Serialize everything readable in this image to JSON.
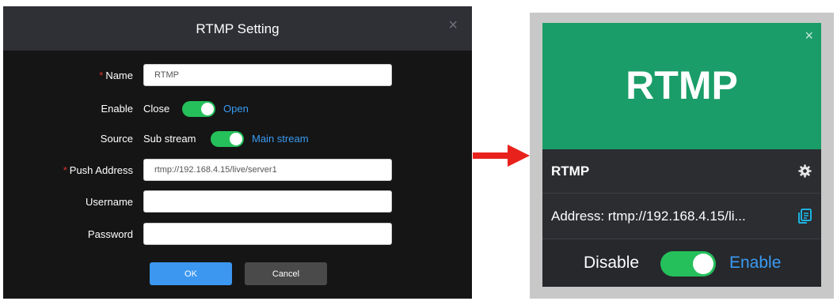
{
  "dialog": {
    "title": "RTMP Setting",
    "close_glyph": "×",
    "required_mark": "*",
    "name": {
      "label": "Name",
      "value": "RTMP"
    },
    "enable": {
      "label": "Enable",
      "off_text": "Close",
      "on_text": "Open",
      "state": "on"
    },
    "source": {
      "label": "Source",
      "off_text": "Sub stream",
      "on_text": "Main stream",
      "state": "on"
    },
    "push_address": {
      "label": "Push Address",
      "value": "rtmp://192.168.4.15/live/server1"
    },
    "username": {
      "label": "Username",
      "value": ""
    },
    "password": {
      "label": "Password",
      "value": ""
    },
    "ok_label": "OK",
    "cancel_label": "Cancel"
  },
  "card": {
    "big_title": "RTMP",
    "close_glyph": "×",
    "name": "RTMP",
    "address": "Address: rtmp://192.168.4.15/li...",
    "disable_text": "Disable",
    "enable_text": "Enable",
    "state": "on"
  },
  "colors": {
    "card_header": "#1a9d68",
    "toggle_on": "#25c05b",
    "link_blue": "#3a9bf2",
    "ok_button": "#3c97f0",
    "arrow": "#e8211c",
    "required": "#e0332b"
  },
  "icons": [
    "close-icon",
    "gear-icon",
    "copy-icon",
    "arrow-right-icon"
  ]
}
